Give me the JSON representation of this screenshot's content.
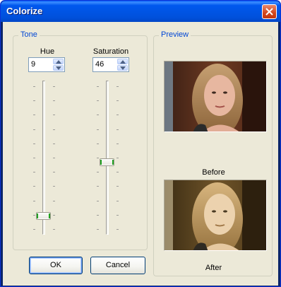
{
  "window": {
    "title": "Colorize"
  },
  "tone": {
    "group_label": "Tone",
    "hue": {
      "label": "Hue",
      "value": "9",
      "slider_fraction": 0.09
    },
    "saturation": {
      "label": "Saturation",
      "value": "46",
      "slider_fraction": 0.46
    }
  },
  "preview": {
    "group_label": "Preview",
    "before_label": "Before",
    "after_label": "After"
  },
  "buttons": {
    "ok": "OK",
    "cancel": "Cancel"
  },
  "icons": {
    "close": "close-icon",
    "spin_up": "spin-up-arrow-icon",
    "spin_down": "spin-down-arrow-icon"
  },
  "colors": {
    "title_bar": "#0054e3",
    "dialog_bg": "#ece9d8",
    "group_label": "#0046d5",
    "close_button": "#d3461c",
    "thumb_grip": "#21a121"
  }
}
